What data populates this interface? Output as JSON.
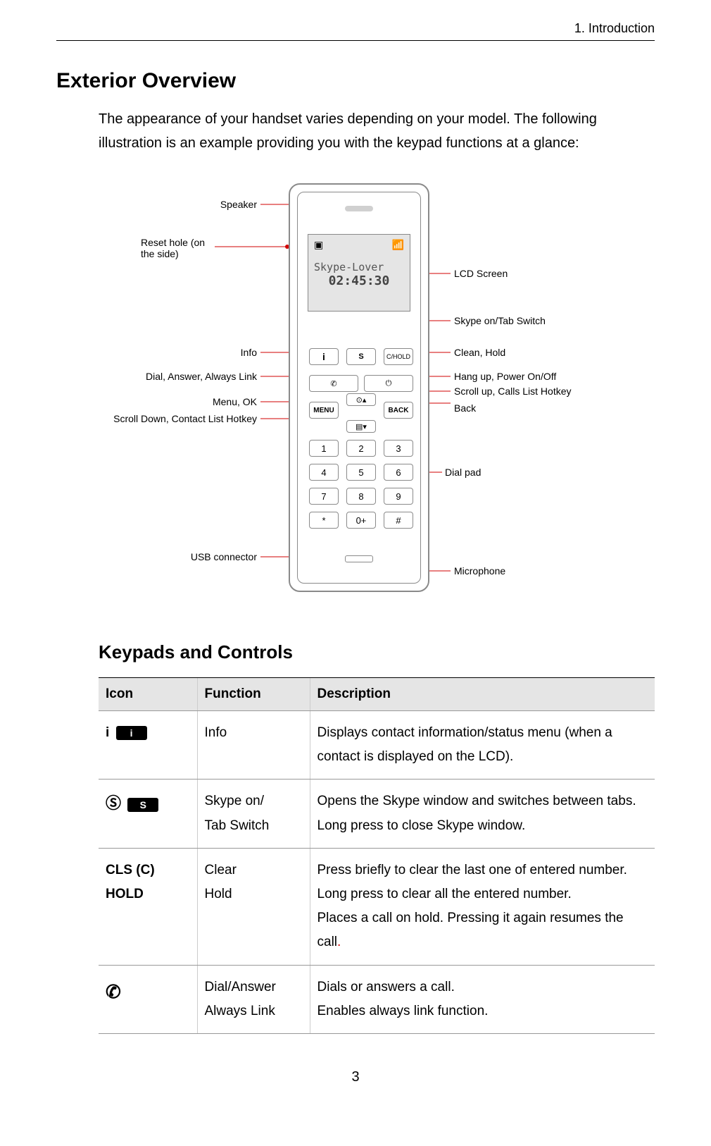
{
  "header": {
    "breadcrumb": "1. Introduction"
  },
  "section1_title": "Exterior Overview",
  "intro_para": "The appearance of your handset varies depending on your model. The following illustration is an example providing you with the keypad functions at a glance:",
  "lcd": {
    "name": "Skype-Lover",
    "time": "02:45:30"
  },
  "keys": {
    "info": "i",
    "skype": "S",
    "chold": "C/HOLD",
    "menu": "MENU",
    "back": "BACK",
    "d1": "1",
    "d2": "2",
    "d3": "3",
    "d4": "4",
    "d5": "5",
    "d6": "6",
    "d7": "7",
    "d8": "8",
    "d9": "9",
    "dstar": "*",
    "d0": "0+",
    "dhash": "#"
  },
  "callouts": {
    "speaker": "Speaker",
    "reset": "Reset hole (on the side)",
    "info": "Info",
    "dial_answer": "Dial, Answer, Always Link",
    "menu_ok": "Menu, OK",
    "scroll_down": "Scroll Down, Contact List Hotkey",
    "usb": "USB connector",
    "lcd": "LCD Screen",
    "skype_tab": "Skype on/Tab Switch",
    "clean_hold": "Clean, Hold",
    "hangup": "Hang up, Power On/Off",
    "scroll_up": "Scroll up, Calls List Hotkey",
    "back": "Back",
    "dialpad": "Dial pad",
    "mic": "Microphone"
  },
  "section2_title": "Keypads and Controls",
  "table": {
    "headers": {
      "icon": "Icon",
      "func": "Function",
      "desc": "Description"
    },
    "rows": [
      {
        "icon_text": "i",
        "icon_pill": "i",
        "func": "Info",
        "desc": "Displays contact information/status menu (when a contact is displayed on the LCD)."
      },
      {
        "icon_text": "S",
        "icon_pill": "S",
        "func": "Skype on/\nTab Switch",
        "desc": "Opens the Skype window and switches between tabs. Long press to close Skype window."
      },
      {
        "icon_text": "CLS (C)\nHOLD",
        "func": "Clear\nHold",
        "desc": "Press briefly to clear the last one of entered number. Long press to clear all the entered number.\nPlaces a call on hold. Pressing it again resumes the call",
        "red_tail": "."
      },
      {
        "icon_text": "✆",
        "func": "Dial/Answer\nAlways Link",
        "desc": "Dials or answers a call.\nEnables always link function."
      }
    ]
  },
  "page_number": "3"
}
